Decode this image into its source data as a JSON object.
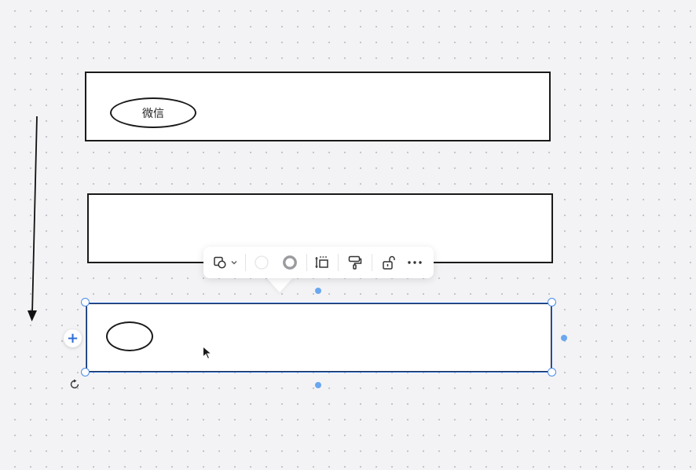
{
  "canvas": {
    "background": "#f3f3f5",
    "dot_grid": true
  },
  "shapes": {
    "rect1": {
      "ellipse_label": "微信"
    },
    "rect3": {
      "ellipse_label": ""
    }
  },
  "toolbar": {
    "items": [
      {
        "icon": "shape-type-icon",
        "dropdown": true
      },
      {
        "icon": "fill-color-icon"
      },
      {
        "icon": "border-color-icon"
      },
      {
        "icon": "align-icon"
      },
      {
        "icon": "format-painter-icon"
      },
      {
        "icon": "unlock-icon"
      },
      {
        "icon": "more-icon"
      }
    ]
  },
  "colors": {
    "selection": "#2f6fd6",
    "handle_border": "#4a8be8",
    "anchor": "#6aa7f0",
    "stroke": "#1a1a1a"
  }
}
